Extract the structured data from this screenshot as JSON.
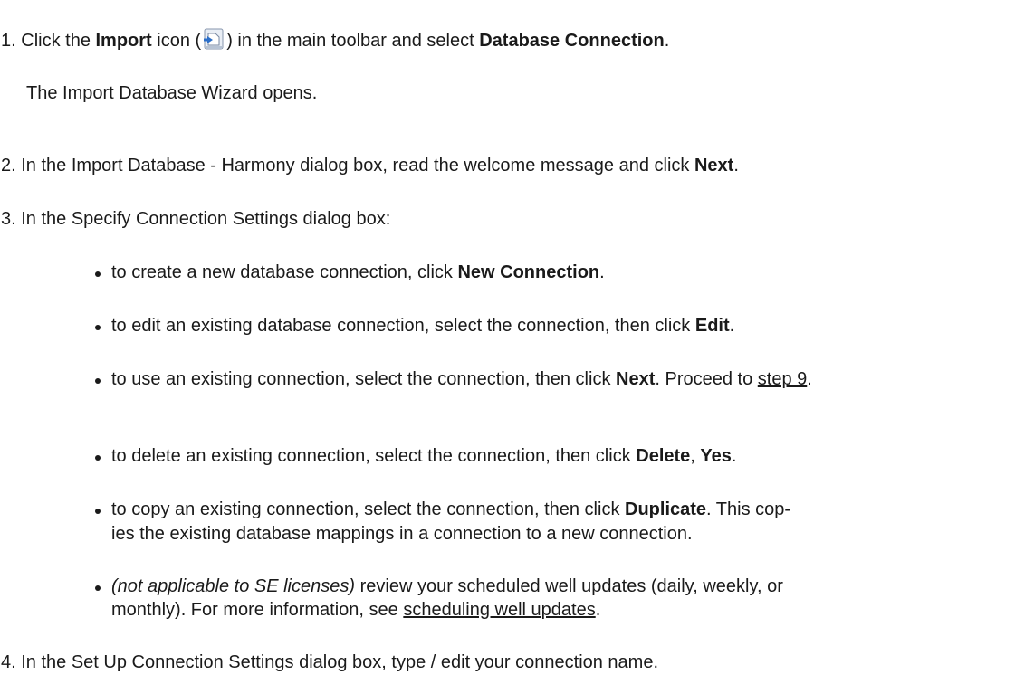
{
  "steps": [
    {
      "number": "1.",
      "parts": {
        "a": "Click the ",
        "b": "Import",
        "c": " icon (",
        "d": ") in the main toolbar and select ",
        "e": "Database Connection",
        "f": "."
      },
      "icon": "import-icon",
      "note": "The Import Database Wizard opens."
    },
    {
      "number": "2.",
      "parts": {
        "a": "In the Import Database - Harmony dialog box, read the welcome message and click ",
        "b": "Next",
        "c": "."
      }
    },
    {
      "number": "3.",
      "text": "In the Specify Connection Settings dialog box:",
      "bullets": [
        {
          "a": "to create a new database connection, click ",
          "b": "New Connection",
          "c": "."
        },
        {
          "a": "to edit an existing database connection, select the connection, then click ",
          "b": "Edit",
          "c": "."
        },
        {
          "a": "to use an existing connection, select the connection, then click ",
          "b": "Next",
          "c": ". Proceed to ",
          "link": "step 9",
          "d": "."
        },
        {
          "a": "to delete an existing connection, select the connection, then click ",
          "b": "Delete",
          "c": ", ",
          "b2": "Yes",
          "d": "."
        },
        {
          "a": "to copy an existing connection, select the connection, then click ",
          "b": "Duplicate",
          "c": ". This cop-",
          "line2": "ies the existing database mappings in a connection to a new connection."
        },
        {
          "italic": "(not applicable to SE licenses)",
          "a": " review your scheduled well updates (daily, weekly, or",
          "line2": "monthly). For more information, see ",
          "link": "scheduling well updates",
          "d": "."
        }
      ]
    },
    {
      "number": "4.",
      "text": "In the Set Up Connection Settings dialog box, type / edit your connection name."
    }
  ]
}
